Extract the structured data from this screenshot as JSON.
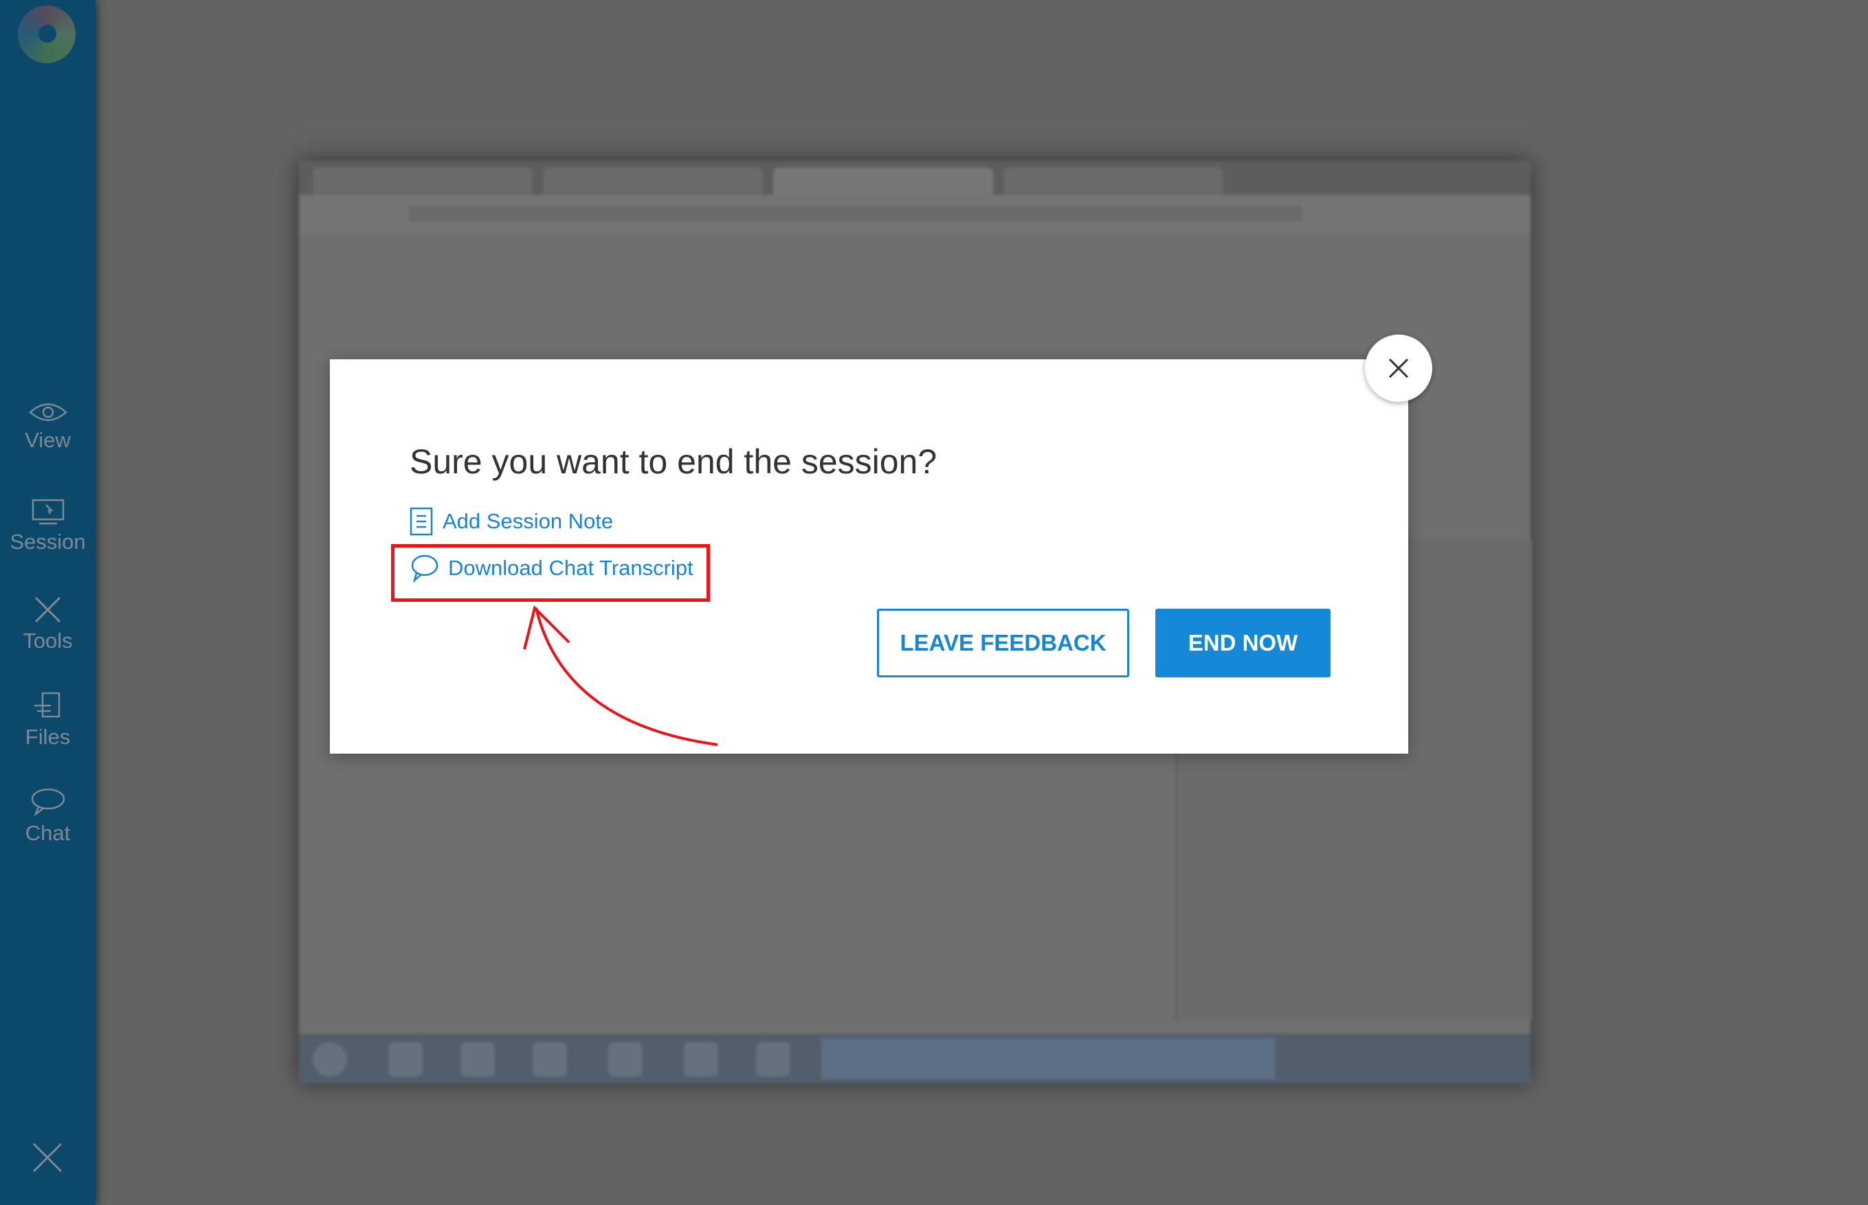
{
  "sidebar": {
    "items": [
      {
        "label": "View",
        "icon": "eye-icon"
      },
      {
        "label": "Session",
        "icon": "monitor-cursor-icon"
      },
      {
        "label": "Tools",
        "icon": "tools-icon"
      },
      {
        "label": "Files",
        "icon": "files-icon"
      },
      {
        "label": "Chat",
        "icon": "chat-bubble-icon"
      }
    ],
    "close_icon": "close-icon"
  },
  "dialog": {
    "title": "Sure you want to end the session?",
    "add_note_label": "Add Session Note",
    "download_transcript_label": "Download Chat Transcript",
    "leave_feedback_label": "LEAVE FEEDBACK",
    "end_now_label": "END NOW"
  },
  "colors": {
    "accent": "#1589d8",
    "highlight": "#e8161b",
    "sidebar": "#0b4869"
  }
}
